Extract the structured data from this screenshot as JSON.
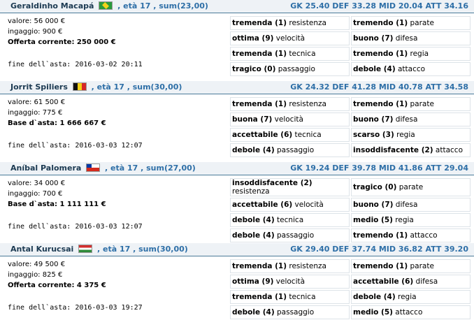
{
  "players": [
    {
      "name": "Geraldinho Macapá",
      "flag": "flag-brazil-icon",
      "meta": ", età 17 , sum(23,00)",
      "stats": "GK 25.40 DEF 33.28 MID 20.04 ATT 34.16",
      "valore": "valore: 56 000 €",
      "ingaggio": "ingaggio: 900 €",
      "offer": "Offerta corrente: 250 000 €",
      "fine": "fine dell`asta: 2016-03-02 20:11",
      "skills": [
        [
          "tremenda (1)",
          "resistenza",
          "tremendo (1)",
          "parate"
        ],
        [
          "ottima (9)",
          "velocità",
          "buono (7)",
          "difesa"
        ],
        [
          "tremenda (1)",
          "tecnica",
          "tremendo (1)",
          "regia"
        ],
        [
          "tragico (0)",
          "passaggio",
          "debole (4)",
          "attacco"
        ]
      ]
    },
    {
      "name": "Jorrit Spiliers",
      "flag": "flag-belgium-icon",
      "meta": ", età 17 , sum(30,00)",
      "stats": "GK 24.32 DEF 41.28 MID 40.78 ATT 34.58",
      "valore": "valore: 61 500 €",
      "ingaggio": "ingaggio: 775 €",
      "offer": "Base d`asta: 1 666 667 €",
      "fine": "fine dell`asta: 2016-03-03 12:07",
      "skills": [
        [
          "tremenda (1)",
          "resistenza",
          "tremendo (1)",
          "parate"
        ],
        [
          "buona (7)",
          "velocità",
          "buono (7)",
          "difesa"
        ],
        [
          "accettabile (6)",
          "tecnica",
          "scarso (3)",
          "regia"
        ],
        [
          "debole (4)",
          "passaggio",
          "insoddisfacente (2)",
          "attacco"
        ]
      ]
    },
    {
      "name": "Aníbal Palomera",
      "flag": "flag-chile-icon",
      "meta": ", età 17 , sum(27,00)",
      "stats": "GK 19.24 DEF 39.78 MID 41.86 ATT 29.04",
      "valore": "valore: 34 000 €",
      "ingaggio": "ingaggio: 700 €",
      "offer": "Base d`asta: 1 111 111 €",
      "fine": "fine dell`asta: 2016-03-03 12:07",
      "skills": [
        [
          "insoddisfacente (2)",
          "resistenza",
          "tragico (0)",
          "parate"
        ],
        [
          "accettabile (6)",
          "velocità",
          "buono (7)",
          "difesa"
        ],
        [
          "debole (4)",
          "tecnica",
          "medio (5)",
          "regia"
        ],
        [
          "debole (4)",
          "passaggio",
          "tremendo (1)",
          "attacco"
        ]
      ]
    },
    {
      "name": "Antal Kurucsai",
      "flag": "flag-hungary-icon",
      "meta": ", età 17 , sum(30,00)",
      "stats": "GK 29.40 DEF 37.74 MID 36.82 ATT 39.20",
      "valore": "valore: 49 500 €",
      "ingaggio": "ingaggio: 825 €",
      "offer": "Offerta corrente: 4 375 €",
      "fine": "fine dell`asta: 2016-03-03 19:27",
      "skills": [
        [
          "tremenda (1)",
          "resistenza",
          "tremendo (1)",
          "parate"
        ],
        [
          "ottima (9)",
          "velocità",
          "accettabile (6)",
          "difesa"
        ],
        [
          "tremenda (1)",
          "tecnica",
          "debole (4)",
          "regia"
        ],
        [
          "debole (4)",
          "passaggio",
          "medio (5)",
          "attacco"
        ]
      ]
    }
  ]
}
